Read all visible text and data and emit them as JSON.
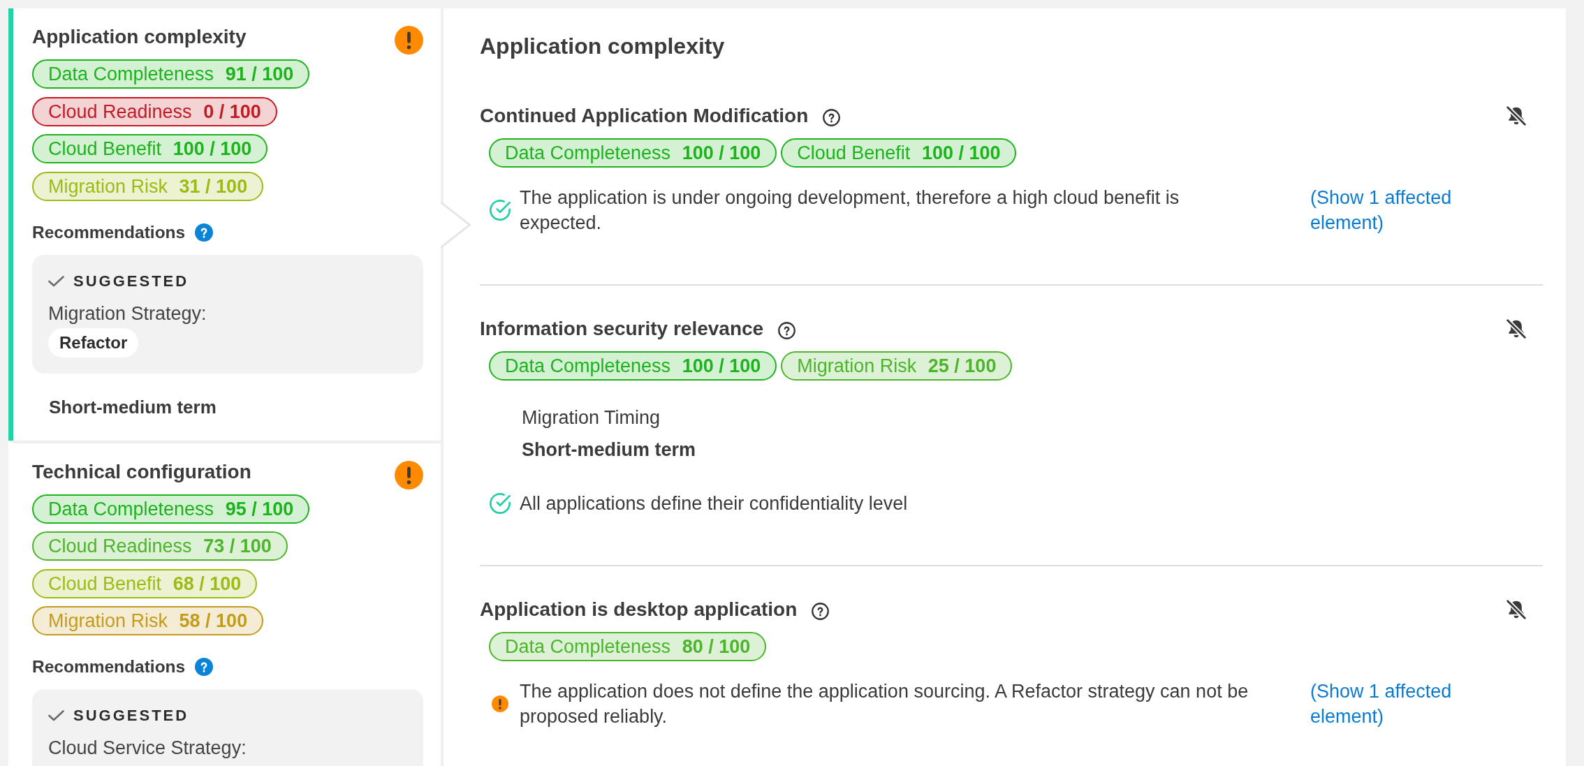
{
  "sidebar": {
    "cards": [
      {
        "title": "Application complexity",
        "selected": true,
        "warning": true,
        "scores": [
          {
            "label": "Data Completeness",
            "value": "91 / 100",
            "color": "#1db31d"
          },
          {
            "label": "Cloud Readiness",
            "value": "0 / 100",
            "color": "#c41a24"
          },
          {
            "label": "Cloud Benefit",
            "value": "100 / 100",
            "color": "#1db31d"
          },
          {
            "label": "Migration Risk",
            "value": "31 / 100",
            "color": "#9cbb14"
          }
        ],
        "recommendations": {
          "title": "Recommendations",
          "status": "SUGGESTED",
          "strategy_label": "Migration Strategy:",
          "strategy": "Refactor",
          "timing": "Short-medium term"
        }
      },
      {
        "title": "Technical configuration",
        "selected": false,
        "warning": true,
        "scores": [
          {
            "label": "Data Completeness",
            "value": "95 / 100",
            "color": "#1db31d"
          },
          {
            "label": "Cloud Readiness",
            "value": "73 / 100",
            "color": "#4cb52a"
          },
          {
            "label": "Cloud Benefit",
            "value": "68 / 100",
            "color": "#9cbb14"
          },
          {
            "label": "Migration Risk",
            "value": "58 / 100",
            "color": "#c49b1b"
          }
        ],
        "recommendations": {
          "title": "Recommendations",
          "status": "SUGGESTED",
          "strategy_label": "Cloud Service Strategy:"
        }
      }
    ]
  },
  "detail": {
    "title": "Application complexity",
    "rules": [
      {
        "title": "Continued Application Modification",
        "scores": [
          {
            "label": "Data Completeness",
            "value": "100 / 100",
            "color": "#1db31d"
          },
          {
            "label": "Cloud Benefit",
            "value": "100 / 100",
            "color": "#1db31d"
          }
        ],
        "messages": [
          {
            "kind": "passed",
            "text": "The application is under ongoing development, therefore a high cloud benefit is expected.",
            "link": "(Show 1 affected element)"
          }
        ]
      },
      {
        "title": "Information security relevance",
        "scores": [
          {
            "label": "Data Completeness",
            "value": "100 / 100",
            "color": "#1db31d"
          },
          {
            "label": "Migration Risk",
            "value": "25 / 100",
            "color": "#4cb52a"
          }
        ],
        "recommendation": {
          "label": "Migration Timing",
          "value": "Short-medium term"
        },
        "messages": [
          {
            "kind": "passed",
            "text": "All applications define their confidentiality level"
          }
        ]
      },
      {
        "title": "Application is desktop application",
        "scores": [
          {
            "label": "Data Completeness",
            "value": "80 / 100",
            "color": "#4cb52a"
          }
        ],
        "messages": [
          {
            "kind": "warning",
            "text": "The application does not define the application sourcing. A Refactor strategy can not be proposed reliably.",
            "link": "(Show 1 affected element)"
          }
        ]
      }
    ]
  }
}
